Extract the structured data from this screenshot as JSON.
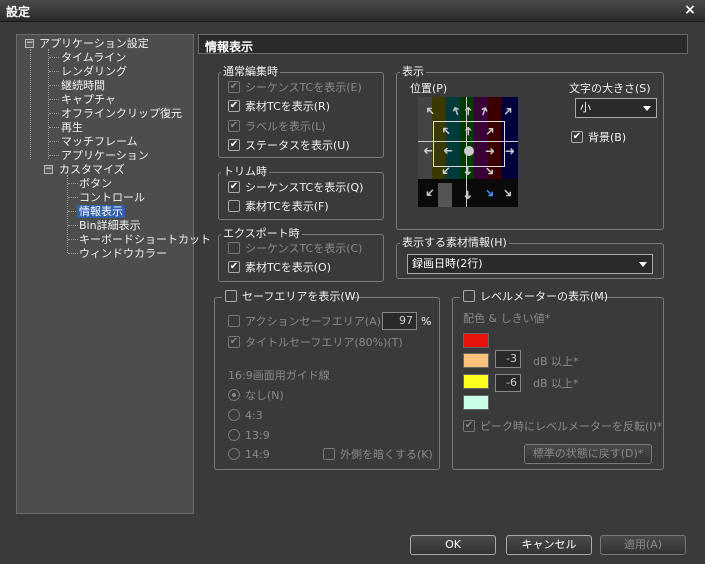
{
  "window": {
    "title": "設定",
    "close": "×"
  },
  "tree": {
    "root": "アプリケーション設定",
    "items": [
      "タイムライン",
      "レンダリング",
      "継続時間",
      "キャプチャ",
      "オフラインクリップ復元",
      "再生",
      "マッチフレーム",
      "アプリケーション"
    ],
    "custom": "カスタマイズ",
    "sub": [
      "ボタン",
      "コントロール",
      "情報表示",
      "Bin詳細表示",
      "キーボードショートカット",
      "ウィンドウカラー"
    ],
    "expander": "−"
  },
  "header": {
    "title": "情報表示"
  },
  "normal": {
    "title": "通常編集時",
    "options": [
      {
        "label": "シーケンスTCを表示(E)",
        "checked": true,
        "disabled": true
      },
      {
        "label": "素材TCを表示(R)",
        "checked": true,
        "disabled": false
      },
      {
        "label": "ラベルを表示(L)",
        "checked": true,
        "disabled": true
      },
      {
        "label": "ステータスを表示(U)",
        "checked": true,
        "disabled": false
      }
    ]
  },
  "trim": {
    "title": "トリム時",
    "options": [
      {
        "label": "シーケンスTCを表示(Q)",
        "checked": true,
        "disabled": false
      },
      {
        "label": "素材TCを表示(F)",
        "checked": false,
        "disabled": false
      }
    ]
  },
  "export": {
    "title": "エクスポート時",
    "options": [
      {
        "label": "シーケンスTCを表示(C)",
        "checked": false,
        "disabled": true
      },
      {
        "label": "素材TCを表示(O)",
        "checked": true,
        "disabled": false
      }
    ]
  },
  "display": {
    "title": "表示",
    "position_label": "位置(P)",
    "size_label": "文字の大きさ(S)",
    "size_value": "小",
    "bg_label": "背景(B)",
    "bg_checked": true
  },
  "clipinfo": {
    "title": "表示する素材情報(H)",
    "value": "録画日時(2行)"
  },
  "safe": {
    "title": "セーフエリアを表示(W)",
    "action_label": "アクションセーフエリア(A)",
    "action_value": "97",
    "action_unit": "%",
    "title_label": "タイトルセーフエリア(80%)(T)",
    "guide_title": "16:9画面用ガイド線",
    "radios": [
      "なし(N)",
      "4:3",
      "13:9",
      "14:9"
    ],
    "outside_label": "外側を暗くする(K)"
  },
  "level": {
    "title": "レベルメーターの表示(M)",
    "color_title": "配色 & しきい値*",
    "colors": [
      "#e8140c",
      "#ffc27a",
      "#ffff1e",
      "#c8ffe6"
    ],
    "th1": "-3",
    "th2": "-6",
    "db_label": "dB 以上*",
    "reverse_label": "ピーク時にレベルメーターを反転(I)*",
    "reset_label": "標準の状態に戻す(D)*"
  },
  "buttons": {
    "ok": "OK",
    "cancel": "キャンセル",
    "apply": "適用(A)"
  },
  "icons": {
    "check": "✔",
    "arrow": "➜"
  }
}
